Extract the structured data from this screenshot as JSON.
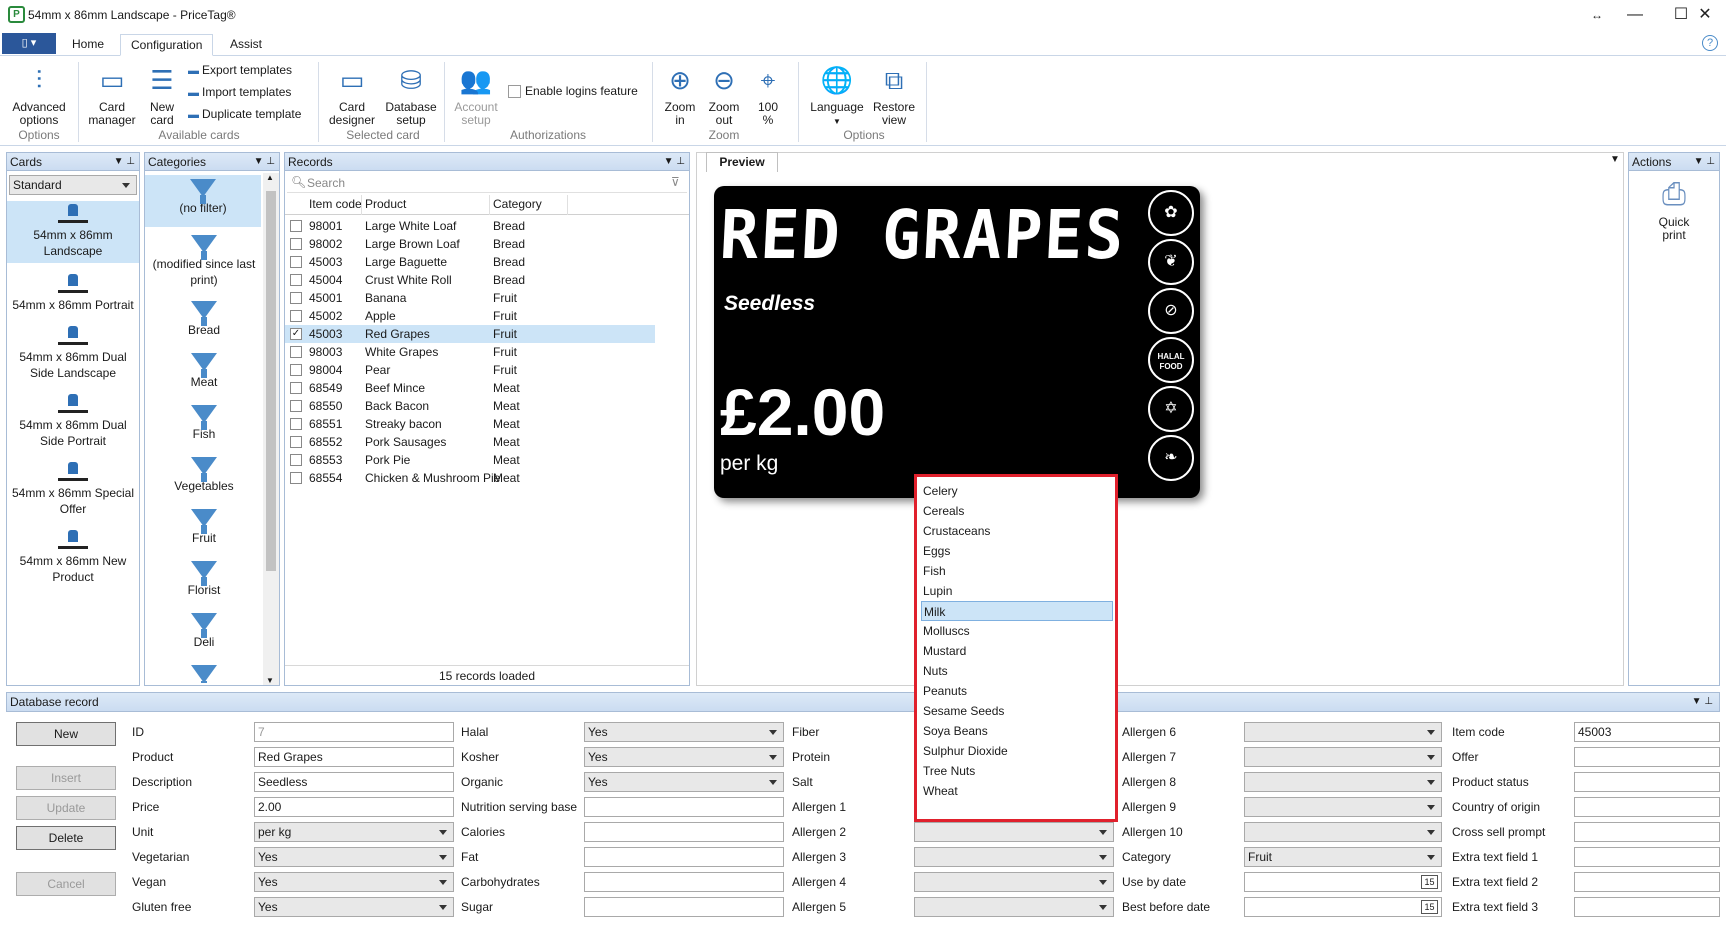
{
  "window": {
    "title": "54mm x 86mm Landscape - PriceTag®",
    "logo": "P"
  },
  "ribbon": {
    "tabs": [
      "Home",
      "Configuration",
      "Assist"
    ],
    "groups": {
      "options": "Options",
      "available_cards": "Available cards",
      "selected_card": "Selected card",
      "authorizations": "Authorizations",
      "zoom": "Zoom",
      "options2": "Options"
    },
    "advanced_options": "Advanced\noptions",
    "card_manager": "Card\nmanager",
    "new_card": "New\ncard",
    "export_templates": "Export templates",
    "import_templates": "Import templates",
    "duplicate_template": "Duplicate template",
    "card_designer": "Card\ndesigner",
    "database_setup": "Database\nsetup",
    "account_setup": "Account\nsetup",
    "enable_logins": "Enable logins feature",
    "zoom_in": "Zoom\nin",
    "zoom_out": "Zoom\nout",
    "zoom_100": "100\n%",
    "language": "Language",
    "restore_view": "Restore\nview"
  },
  "cards_pane": {
    "title": "Cards",
    "selected": "Standard",
    "items": [
      "54mm x 86mm Landscape",
      "54mm x 86mm Portrait",
      "54mm x 86mm Dual Side Landscape",
      "54mm x 86mm Dual Side Portrait",
      "54mm x 86mm Special Offer",
      "54mm x 86mm New Product"
    ]
  },
  "categories_pane": {
    "title": "Categories",
    "items": [
      "(no filter)",
      "(modified since last print)",
      "Bread",
      "Meat",
      "Fish",
      "Vegetables",
      "Fruit",
      "Florist",
      "Deli"
    ]
  },
  "records_pane": {
    "title": "Records",
    "search_placeholder": "Search",
    "columns": [
      "Item code",
      "Product",
      "Category"
    ],
    "rows": [
      {
        "code": "98001",
        "product": "Large White Loaf",
        "category": "Bread",
        "checked": ""
      },
      {
        "code": "98002",
        "product": "Large Brown Loaf",
        "category": "Bread",
        "checked": ""
      },
      {
        "code": "45003",
        "product": "Large Baguette",
        "category": "Bread",
        "checked": ""
      },
      {
        "code": "45004",
        "product": "Crust White Roll",
        "category": "Bread",
        "checked": ""
      },
      {
        "code": "45001",
        "product": "Banana",
        "category": "Fruit",
        "checked": ""
      },
      {
        "code": "45002",
        "product": "Apple",
        "category": "Fruit",
        "checked": ""
      },
      {
        "code": "45003",
        "product": "Red Grapes",
        "category": "Fruit",
        "checked": "✓"
      },
      {
        "code": "98003",
        "product": "White Grapes",
        "category": "Fruit",
        "checked": ""
      },
      {
        "code": "98004",
        "product": "Pear",
        "category": "Fruit",
        "checked": ""
      },
      {
        "code": "68549",
        "product": "Beef Mince",
        "category": "Meat",
        "checked": ""
      },
      {
        "code": "68550",
        "product": "Back Bacon",
        "category": "Meat",
        "checked": ""
      },
      {
        "code": "68551",
        "product": "Streaky bacon",
        "category": "Meat",
        "checked": ""
      },
      {
        "code": "68552",
        "product": "Pork Sausages",
        "category": "Meat",
        "checked": ""
      },
      {
        "code": "68553",
        "product": "Pork Pie",
        "category": "Meat",
        "checked": ""
      },
      {
        "code": "68554",
        "product": "Chicken & Mushroom Pie",
        "category": "Meat",
        "checked": ""
      }
    ],
    "status": "15 records loaded"
  },
  "preview": {
    "tab": "Preview",
    "product": "RED GRAPES",
    "description": "Seedless",
    "price": "£2.00",
    "unit": "per kg",
    "badges": [
      "vegetarian-icon",
      "vegan-icon",
      "gluten-free-icon",
      "halal-icon",
      "kosher-icon",
      "organic-icon"
    ],
    "halal_label": "HALAL\nFOOD"
  },
  "actions_pane": {
    "title": "Actions",
    "quick_print": "Quick\nprint"
  },
  "allergen_dropdown": {
    "options": [
      "Celery",
      "Cereals",
      "Crustaceans",
      "Eggs",
      "Fish",
      "Lupin",
      "Milk",
      "Molluscs",
      "Mustard",
      "Nuts",
      "Peanuts",
      "Sesame Seeds",
      "Soya Beans",
      "Sulphur Dioxide",
      "Tree Nuts",
      "Wheat"
    ],
    "highlighted": "Milk"
  },
  "db_record": {
    "title": "Database record",
    "buttons": {
      "new": "New",
      "insert": "Insert",
      "update": "Update",
      "delete": "Delete",
      "cancel": "Cancel"
    },
    "labels": {
      "id": "ID",
      "product": "Product",
      "description": "Description",
      "price": "Price",
      "unit": "Unit",
      "vegetarian": "Vegetarian",
      "vegan": "Vegan",
      "gluten_free": "Gluten free",
      "halal": "Halal",
      "kosher": "Kosher",
      "organic": "Organic",
      "nutrition": "Nutrition serving base",
      "calories": "Calories",
      "fat": "Fat",
      "carbohydrates": "Carbohydrates",
      "sugar": "Sugar",
      "fiber": "Fiber",
      "protein": "Protein",
      "salt": "Salt",
      "allergen1": "Allergen 1",
      "allergen2": "Allergen 2",
      "allergen3": "Allergen 3",
      "allergen4": "Allergen 4",
      "allergen5": "Allergen 5",
      "allergen6": "Allergen 6",
      "allergen7": "Allergen 7",
      "allergen8": "Allergen 8",
      "allergen9": "Allergen 9",
      "allergen10": "Allergen 10",
      "category": "Category",
      "use_by": "Use by date",
      "best_before": "Best before date",
      "item_code": "Item code",
      "offer": "Offer",
      "product_status": "Product status",
      "country": "Country of origin",
      "cross_sell": "Cross sell prompt",
      "extra1": "Extra text field 1",
      "extra2": "Extra text field 2",
      "extra3": "Extra text field 3"
    },
    "values": {
      "id": "7",
      "product": "Red Grapes",
      "description": "Seedless",
      "price": "2.00",
      "unit": "per kg",
      "vegetarian": "Yes",
      "vegan": "Yes",
      "gluten_free": "Yes",
      "halal": "Yes",
      "kosher": "Yes",
      "organic": "Yes",
      "category": "Fruit",
      "item_code": "45003",
      "calendar_day": "15"
    }
  },
  "colors": {
    "accent": "#2b579a",
    "selection": "#cce4f7",
    "highlight_border": "#e0202c"
  }
}
